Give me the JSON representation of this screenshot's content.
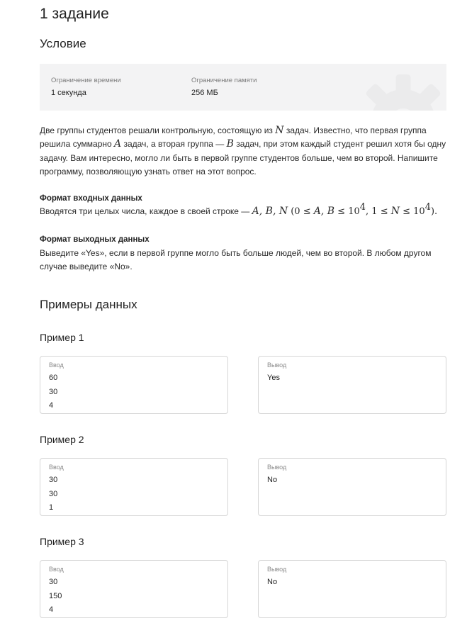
{
  "task_title": "1 задание",
  "condition_title": "Условие",
  "limits": {
    "time_label": "Ограничение времени",
    "time_value": "1 секунда",
    "memory_label": "Ограничение памяти",
    "memory_value": "256 МБ"
  },
  "statement": {
    "line1_a": "Две группы студентов решали контрольную, состоящую из ",
    "var_n": "N",
    "line1_b": " задач. Известно, что первая группа",
    "line2_a": "решила суммарно ",
    "var_a": "A",
    "line2_b": " задач, а вторая группа — ",
    "var_b": "B",
    "line2_c": " задач, при этом каждый студент решил хотя бы одну",
    "line3": "задачу. Вам интересно, могло ли быть в первой группе студентов больше, чем во второй. Напишите",
    "line4": "программу, позволяющую узнать ответ на этот вопрос."
  },
  "input_format": {
    "title": "Формат входных данных",
    "text": "Вводятся три целых числа, каждое в своей строке — ",
    "math_vars": "A, B, N",
    "math_paren_open": " (0 ≤ ",
    "math_ab": "A, B",
    "math_le": " ≤ 10",
    "math_exp": "4",
    "math_mid": ", 1 ≤ ",
    "math_n": "N",
    "math_le2": " ≤ 10",
    "math_exp2": "4",
    "math_close": ")."
  },
  "output_format": {
    "title": "Формат выходных данных",
    "line1": "Выведите «Yes», если в первой группе могло быть больше людей, чем во второй. В любом другом",
    "line2": "случае выведите «No»."
  },
  "examples_title": "Примеры данных",
  "examples": [
    {
      "title": "Пример 1",
      "input_label": "Ввод",
      "input": "60\n30\n4",
      "output_label": "Вывод",
      "output": "Yes"
    },
    {
      "title": "Пример 2",
      "input_label": "Ввод",
      "input": "30\n30\n1",
      "output_label": "Вывод",
      "output": "No"
    },
    {
      "title": "Пример 3",
      "input_label": "Ввод",
      "input": "30\n150\n4",
      "output_label": "Вывод",
      "output": "No"
    }
  ],
  "icons": {
    "limits_background": "gear-icon"
  },
  "colors": {
    "limits_bg": "#f3f3f4",
    "box_border": "#d6d6d6",
    "label_gray": "#8a8a8a"
  }
}
